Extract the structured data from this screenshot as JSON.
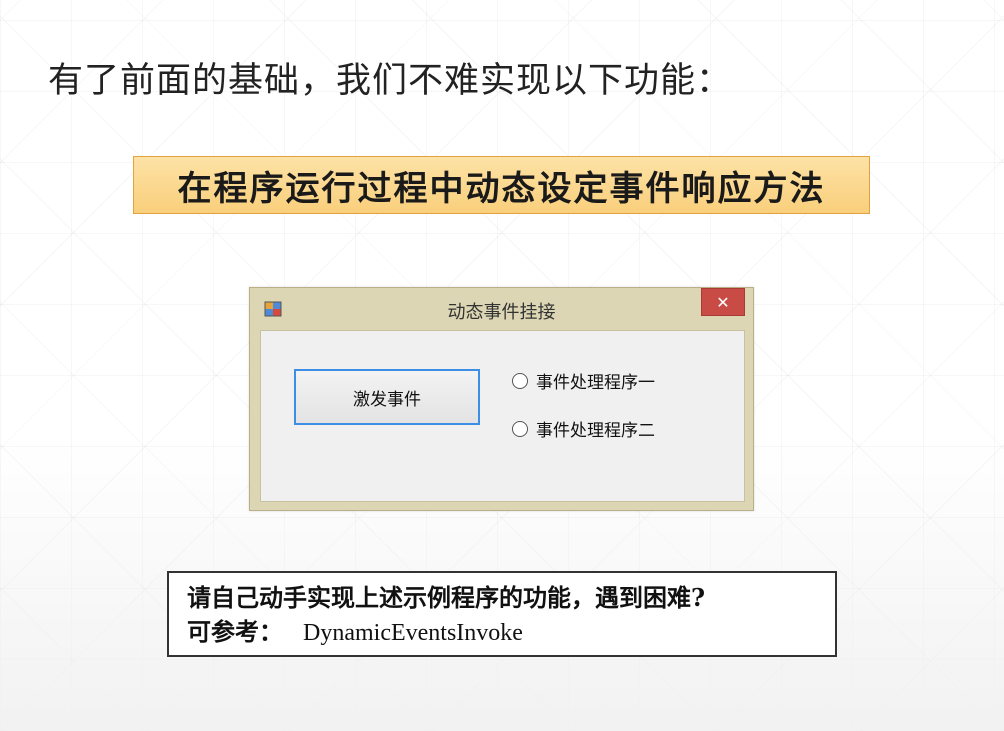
{
  "slide": {
    "title": "有了前面的基础，我们不难实现以下功能：",
    "highlight": "在程序运行过程中动态设定事件响应方法"
  },
  "window": {
    "title": "动态事件挂接",
    "app_icon": "winforms-app-icon",
    "close_glyph": "✕",
    "button_label": "激发事件",
    "radio_options": [
      {
        "label": "事件处理程序一",
        "checked": false
      },
      {
        "label": "事件处理程序二",
        "checked": false
      }
    ],
    "colors": {
      "frame": "#ddd6b4",
      "close": "#c94b45",
      "button_border": "#3c8ee6"
    }
  },
  "note": {
    "line1": "请自己动手实现上述示例程序的功能，遇到困难?",
    "line2_label": "可参考：",
    "line2_ref": "DynamicEventsInvoke"
  },
  "colors": {
    "highlight_bg": "#f9cf7b",
    "highlight_border": "#e3a23f"
  }
}
